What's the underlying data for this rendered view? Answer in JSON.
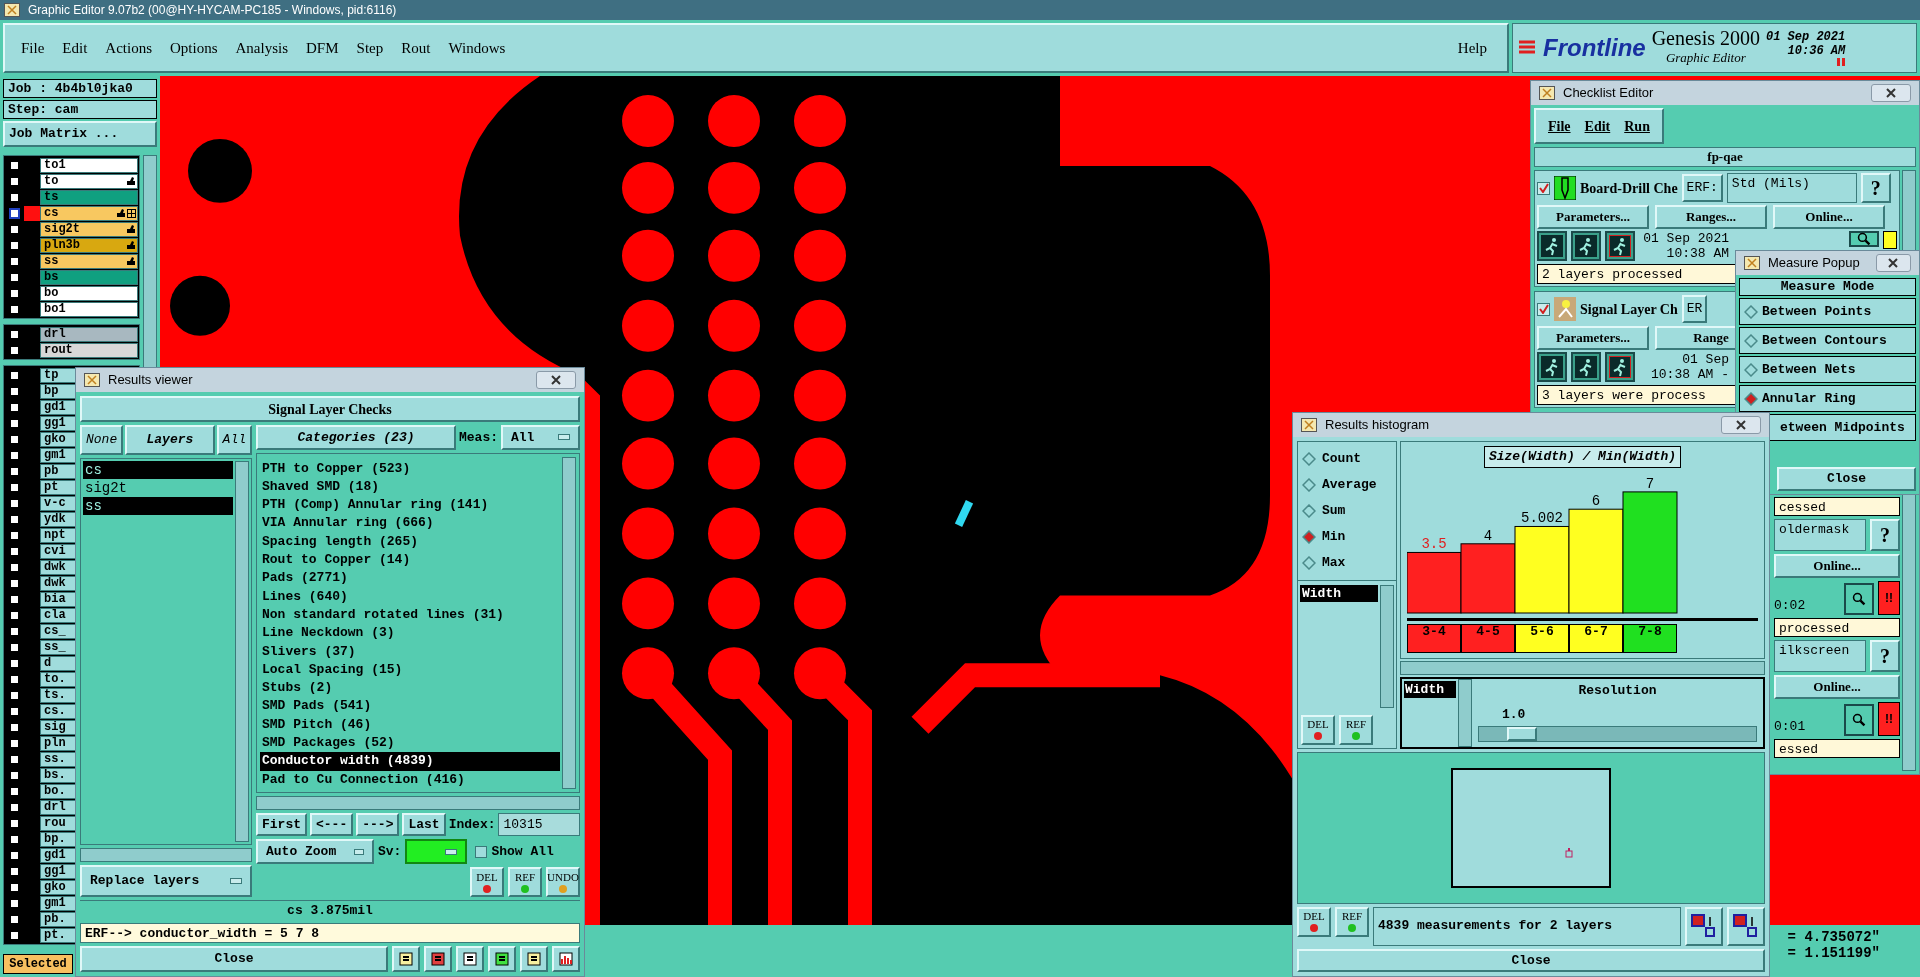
{
  "window": {
    "title": "Graphic Editor 9.07b2 (00@HY-HYCAM-PC185 - Windows, pid:6116)"
  },
  "menu": [
    "File",
    "Edit",
    "Actions",
    "Options",
    "Analysis",
    "DFM",
    "Step",
    "Rout",
    "Windows"
  ],
  "help": "Help",
  "brand": {
    "logo": "Frontline",
    "product": "Genesis 2000",
    "subtitle": "Graphic Editor",
    "date": "01 Sep 2021",
    "time": "10:36 AM"
  },
  "job": {
    "job": "Job : 4b4bl0jka0",
    "step": "Step: cam",
    "matrix_button": "Job Matrix ..."
  },
  "layer_groups": [
    {
      "layers": [
        {
          "name": "to1",
          "color": "#ffffff",
          "checked": false,
          "affected": false,
          "work": false
        },
        {
          "name": "to",
          "color": "#ffffff",
          "checked": false,
          "affected": true,
          "work": false
        },
        {
          "name": "ts",
          "color": "#10a080",
          "checked": false,
          "affected": false,
          "work": false
        },
        {
          "name": "cs",
          "color": "#f8c860",
          "checked": false,
          "affected": true,
          "work": true
        },
        {
          "name": "sig2t",
          "color": "#f8c860",
          "checked": false,
          "affected": true,
          "work": false
        },
        {
          "name": "pln3b",
          "color": "#d8a810",
          "checked": false,
          "affected": true,
          "work": false
        },
        {
          "name": "ss",
          "color": "#f8c860",
          "checked": false,
          "affected": true,
          "work": false
        },
        {
          "name": "bs",
          "color": "#10a080",
          "checked": false,
          "affected": false,
          "work": false
        },
        {
          "name": "bo",
          "color": "#ffffff",
          "checked": false,
          "affected": false,
          "work": false
        },
        {
          "name": "bo1",
          "color": "#ffffff",
          "checked": false,
          "affected": false,
          "work": false
        }
      ]
    },
    {
      "layers": [
        {
          "name": "drl",
          "color": "#a8b8c0",
          "checked": false,
          "affected": false,
          "work": false
        },
        {
          "name": "rout",
          "color": "#d8d8d8",
          "checked": false,
          "affected": false,
          "work": false
        }
      ]
    },
    {
      "layers": [
        {
          "name": "tp",
          "color": "#a0dcdc",
          "checked": false,
          "affected": false,
          "work": false
        },
        {
          "name": "bp",
          "color": "#a0dcdc",
          "checked": false,
          "affected": false,
          "work": false
        },
        {
          "name": "gd1",
          "color": "#a0dcdc",
          "checked": false,
          "affected": false,
          "work": false
        },
        {
          "name": "gg1",
          "color": "#a0dcdc",
          "checked": false,
          "affected": false,
          "work": false
        },
        {
          "name": "gko",
          "color": "#a0dcdc",
          "checked": false,
          "affected": false,
          "work": false
        },
        {
          "name": "gm1",
          "color": "#a0dcdc",
          "checked": false,
          "affected": false,
          "work": false
        },
        {
          "name": "pb",
          "color": "#a0dcdc",
          "checked": false,
          "affected": false,
          "work": false
        },
        {
          "name": "pt",
          "color": "#a0dcdc",
          "checked": false,
          "affected": false,
          "work": false
        },
        {
          "name": "v-c",
          "color": "#a0dcdc",
          "checked": false,
          "affected": false,
          "work": false
        },
        {
          "name": "ydk",
          "color": "#a0dcdc",
          "checked": false,
          "affected": false,
          "work": false
        },
        {
          "name": "npt",
          "color": "#a0dcdc",
          "checked": false,
          "affected": false,
          "work": false
        },
        {
          "name": "cvi",
          "color": "#a0dcdc",
          "checked": false,
          "affected": false,
          "work": false
        },
        {
          "name": "dwk",
          "color": "#a0dcdc",
          "checked": false,
          "affected": false,
          "work": false
        },
        {
          "name": "dwk",
          "color": "#a0dcdc",
          "checked": false,
          "affected": false,
          "work": false
        },
        {
          "name": "bia",
          "color": "#a0dcdc",
          "checked": false,
          "affected": false,
          "work": false
        },
        {
          "name": "cla",
          "color": "#a0dcdc",
          "checked": false,
          "affected": false,
          "work": false
        },
        {
          "name": "cs_",
          "color": "#a0dcdc",
          "checked": false,
          "affected": false,
          "work": false
        },
        {
          "name": "ss_",
          "color": "#a0dcdc",
          "checked": false,
          "affected": false,
          "work": false
        },
        {
          "name": "d",
          "color": "#a0dcdc",
          "checked": false,
          "affected": false,
          "work": false
        },
        {
          "name": "to.",
          "color": "#a0dcdc",
          "checked": false,
          "affected": false,
          "work": false
        },
        {
          "name": "ts.",
          "color": "#a0dcdc",
          "checked": false,
          "affected": false,
          "work": false
        },
        {
          "name": "cs.",
          "color": "#a0dcdc",
          "checked": false,
          "affected": false,
          "work": false
        },
        {
          "name": "sig",
          "color": "#a0dcdc",
          "checked": false,
          "affected": false,
          "work": false
        },
        {
          "name": "pln",
          "color": "#a0dcdc",
          "checked": false,
          "affected": false,
          "work": false
        },
        {
          "name": "ss.",
          "color": "#a0dcdc",
          "checked": false,
          "affected": false,
          "work": false
        },
        {
          "name": "bs.",
          "color": "#a0dcdc",
          "checked": false,
          "affected": false,
          "work": false
        },
        {
          "name": "bo.",
          "color": "#a0dcdc",
          "checked": false,
          "affected": false,
          "work": false
        },
        {
          "name": "drl",
          "color": "#a0dcdc",
          "checked": false,
          "affected": false,
          "work": false
        },
        {
          "name": "rou",
          "color": "#a0dcdc",
          "checked": false,
          "affected": false,
          "work": false
        },
        {
          "name": "bp.",
          "color": "#a0dcdc",
          "checked": false,
          "affected": false,
          "work": false
        },
        {
          "name": "gd1",
          "color": "#a0dcdc",
          "checked": false,
          "affected": false,
          "work": false
        },
        {
          "name": "gg1",
          "color": "#a0dcdc",
          "checked": false,
          "affected": false,
          "work": false
        },
        {
          "name": "gko",
          "color": "#a0dcdc",
          "checked": false,
          "affected": false,
          "work": false
        },
        {
          "name": "gm1",
          "color": "#a0dcdc",
          "checked": false,
          "affected": false,
          "work": false
        },
        {
          "name": "pb.",
          "color": "#a0dcdc",
          "checked": false,
          "affected": false,
          "work": false
        },
        {
          "name": "pt.",
          "color": "#a0dcdc",
          "checked": false,
          "affected": false,
          "work": false
        }
      ]
    }
  ],
  "selected_button": "Selected",
  "coordinates": [
    "= 4.735072\"",
    "= 1.151199\""
  ],
  "results_viewer": {
    "title": "Results viewer",
    "header": "Signal Layer Checks",
    "layer_buttons": [
      "None",
      "Layers",
      "All"
    ],
    "layers": [
      {
        "name": "cs",
        "selected": true
      },
      {
        "name": "sig2t",
        "selected": false
      },
      {
        "name": "ss",
        "selected": true
      }
    ],
    "categories_button": "Categories (23)",
    "meas_label": "Meas:",
    "meas_value": "All",
    "categories": [
      {
        "label": "PTH to Copper (523)",
        "selected": false
      },
      {
        "label": "Shaved SMD (18)",
        "selected": false
      },
      {
        "label": "PTH (Comp) Annular ring (141)",
        "selected": false
      },
      {
        "label": "VIA Annular ring (666)",
        "selected": false
      },
      {
        "label": "Spacing length (265)",
        "selected": false
      },
      {
        "label": "Rout to Copper (14)",
        "selected": false
      },
      {
        "label": "Pads (2771)",
        "selected": false
      },
      {
        "label": "Lines (640)",
        "selected": false
      },
      {
        "label": "Non standard rotated lines (31)",
        "selected": false
      },
      {
        "label": "Line Neckdown (3)",
        "selected": false
      },
      {
        "label": "Slivers (37)",
        "selected": false
      },
      {
        "label": "Local Spacing (15)",
        "selected": false
      },
      {
        "label": "Stubs (2)",
        "selected": false
      },
      {
        "label": "SMD Pads (541)",
        "selected": false
      },
      {
        "label": "SMD Pitch (46)",
        "selected": false
      },
      {
        "label": "SMD Packages (52)",
        "selected": false
      },
      {
        "label": "Conductor width (4839)",
        "selected": true
      },
      {
        "label": "Pad to Cu Connection (416)",
        "selected": false
      }
    ],
    "nav": [
      "First",
      "<---",
      "--->",
      "Last"
    ],
    "index_label": "Index:",
    "index": "10315",
    "zoom_mode": "Auto Zoom",
    "sv_label": "Sv:",
    "show_all": {
      "label": "Show All",
      "checked": false
    },
    "replace": "Replace layers",
    "actions": [
      "DEL",
      "REF",
      "UNDO"
    ],
    "status": "cs 3.875mil",
    "erf": "ERF--> conductor_width = 5 7 8",
    "close": "Close"
  },
  "histogram": {
    "title": "Results histogram",
    "modes": [
      {
        "label": "Count",
        "selected": false
      },
      {
        "label": "Average",
        "selected": false
      },
      {
        "label": "Sum",
        "selected": false
      },
      {
        "label": "Min",
        "selected": true
      },
      {
        "label": "Max",
        "selected": false
      }
    ],
    "attributes": [
      {
        "label": "Width",
        "selected": true
      }
    ],
    "chart_data": {
      "type": "bar",
      "title": "Size(Width) / Min(Width)",
      "categories": [
        "3-4",
        "4-5",
        "5-6",
        "6-7",
        "7-8"
      ],
      "values": [
        3.5,
        4,
        5.002,
        6,
        7
      ],
      "data_labels": true
    },
    "bins": [
      {
        "color": "#ff2020",
        "below_min": true
      },
      {
        "color": "#ff2020",
        "below_min": false
      },
      {
        "color": "#ffff20",
        "below_min": false
      },
      {
        "color": "#ffff20",
        "below_min": false
      },
      {
        "color": "#20e020",
        "below_min": false
      }
    ],
    "resolution_attributes": [
      {
        "label": "Width",
        "selected": true
      }
    ],
    "resolution": {
      "label": "Resolution",
      "value": "1.0",
      "level": 0.1
    },
    "buttons": [
      "DEL",
      "REF"
    ],
    "footer_buttons": [
      "DEL",
      "REF"
    ],
    "summary": "4839 measurements for 2 layers",
    "close": "Close"
  },
  "measure_popup": {
    "title": "Measure Popup",
    "header": "Measure Mode",
    "options": [
      {
        "label": "Between Points",
        "selected": false,
        "covered": false
      },
      {
        "label": "Between Contours",
        "selected": false,
        "covered": false
      },
      {
        "label": "Between Nets",
        "selected": false,
        "covered": false
      },
      {
        "label": "Annular Ring",
        "selected": true,
        "covered": false
      },
      {
        "label": "etween Midpoints",
        "covered": true
      }
    ],
    "close": "Close"
  },
  "checklist": {
    "title": "Checklist Editor",
    "menu": [
      "File",
      "Edit",
      "Run"
    ],
    "name": "fp-qae",
    "items": [
      {
        "kind": "full",
        "checked": true,
        "name": "Board-Drill Che",
        "erf": "ERF:",
        "erf_value": "Std (Mils)",
        "help": "?",
        "buttons": [
          "Parameters...",
          "Ranges...",
          "Online..."
        ],
        "date": "01 Sep 2021",
        "time": "10:38 AM",
        "color": "#ffff20",
        "status": "2 layers processed"
      },
      {
        "kind": "partial",
        "checked": true,
        "name": "Signal Layer Ch",
        "erf": "ER",
        "buttons": [
          "Parameters...",
          "Range"
        ],
        "date": "01 Sep",
        "time": "10:38 AM -",
        "status": "3 layers were process"
      }
    ],
    "fragments": [
      {
        "kind": "status",
        "text": "cessed"
      },
      {
        "kind": "field",
        "text": "oldermask",
        "help": "?"
      },
      {
        "kind": "button",
        "text": "Online..."
      },
      {
        "kind": "time",
        "text": "0:02",
        "alert": "!!",
        "color": "#ff2020"
      },
      {
        "kind": "status",
        "text": "processed"
      },
      {
        "kind": "field",
        "text": "ilkscreen",
        "help": "?"
      },
      {
        "kind": "button",
        "text": "Online..."
      },
      {
        "kind": "time",
        "text": "0:01",
        "alert": "!!",
        "color": "#ff2020"
      },
      {
        "kind": "status",
        "text": "essed"
      }
    ]
  }
}
